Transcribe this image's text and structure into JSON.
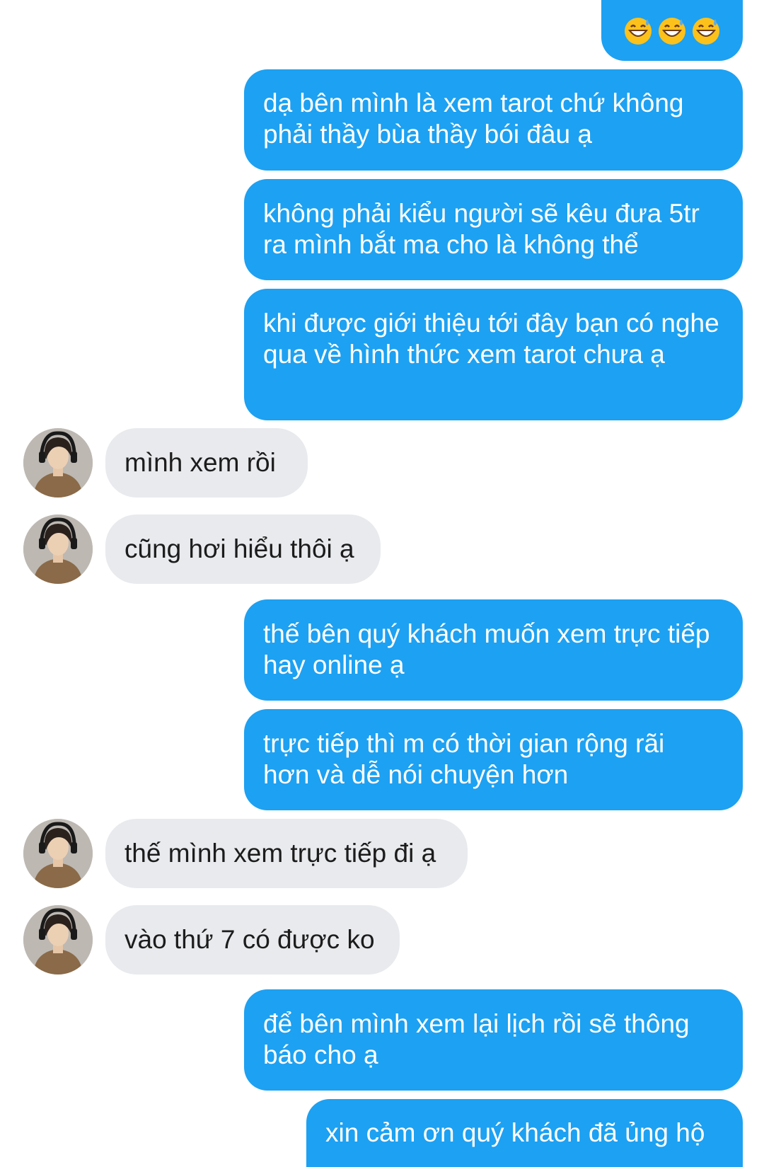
{
  "conversation": {
    "messages": [
      {
        "sender": "me",
        "type": "emoji",
        "emoji_names": [
          "grinning-face-with-sweat-icon",
          "grinning-face-with-sweat-icon",
          "grinning-face-with-sweat-icon"
        ]
      },
      {
        "sender": "me",
        "text": "dạ bên mình là xem tarot chứ không phải thầy bùa thầy bói đâu ạ"
      },
      {
        "sender": "me",
        "text": "không phải kiểu người sẽ kêu đưa 5tr ra mình bắt ma cho là không thể"
      },
      {
        "sender": "me",
        "text": "khi được giới thiệu tới đây bạn có nghe qua về hình thức xem tarot chưa ạ"
      },
      {
        "sender": "other",
        "text": "mình xem rồi"
      },
      {
        "sender": "other",
        "text": "cũng hơi hiểu thôi ạ"
      },
      {
        "sender": "me",
        "text": "thế bên quý khách muốn xem trực tiếp hay online ạ"
      },
      {
        "sender": "me",
        "text": "trực tiếp thì m có thời gian rộng rãi hơn và dễ nói chuyện hơn"
      },
      {
        "sender": "other",
        "text": "thế mình xem trực tiếp đi ạ"
      },
      {
        "sender": "other",
        "text": "vào thứ 7 có được ko"
      },
      {
        "sender": "me",
        "text": "để bên mình xem lại lịch rồi sẽ thông báo cho ạ"
      },
      {
        "sender": "me",
        "text": "xin cảm ơn quý khách đã ủng hộ"
      }
    ]
  },
  "colors": {
    "outgoing_bubble": "#1da1f2",
    "outgoing_text": "#ffffff",
    "incoming_bubble": "#e8eaed",
    "incoming_text": "#1c1c1c",
    "background": "#ffffff"
  }
}
